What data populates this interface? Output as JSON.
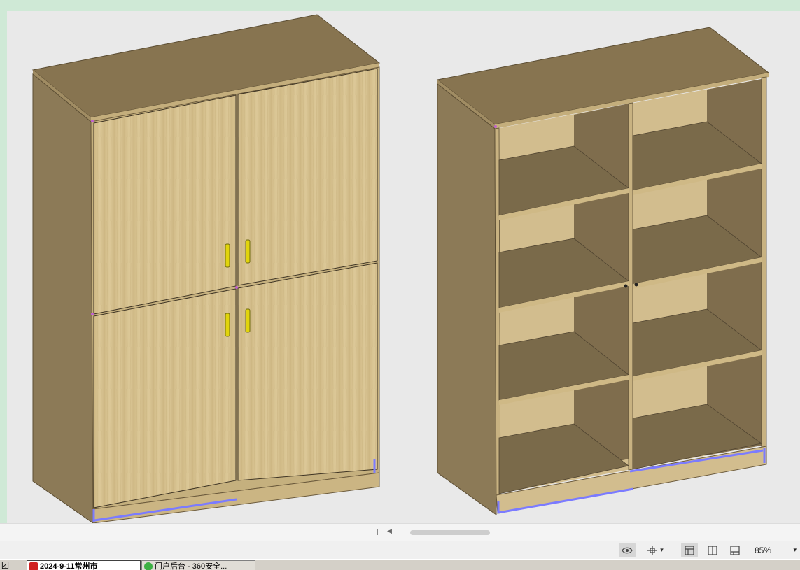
{
  "viewer": {
    "scene": "3d-cabinet-models",
    "objects": [
      "closed-cabinet-four-doors",
      "open-shelf-cabinet"
    ],
    "colors": {
      "viewport_bg": "#e9e9e9",
      "window_border": "#cfe9d6",
      "door_wood": "#d6c08c",
      "carcass_side": "#8c7a57",
      "top_panel": "#877450",
      "shelf_top": "#7a6a4a",
      "edge_highlight": "#7b7bff",
      "handle": "#e1d40c"
    }
  },
  "statusbar": {
    "icons": [
      "eye-icon",
      "move-icon",
      "chevron-down-icon",
      "layout-single-icon",
      "layout-split-icon",
      "layout-panel-icon"
    ],
    "active_layout": "layout-single",
    "zoom_label": "85%"
  },
  "taskbar": {
    "items": [
      {
        "label": "团",
        "icon": "app-icon"
      },
      {
        "label": "2024-9-11常州市",
        "icon": "app-red-icon",
        "active": true
      },
      {
        "label": "门户后台 - 360安全...",
        "icon": "browser-360-icon",
        "active": false
      }
    ]
  }
}
